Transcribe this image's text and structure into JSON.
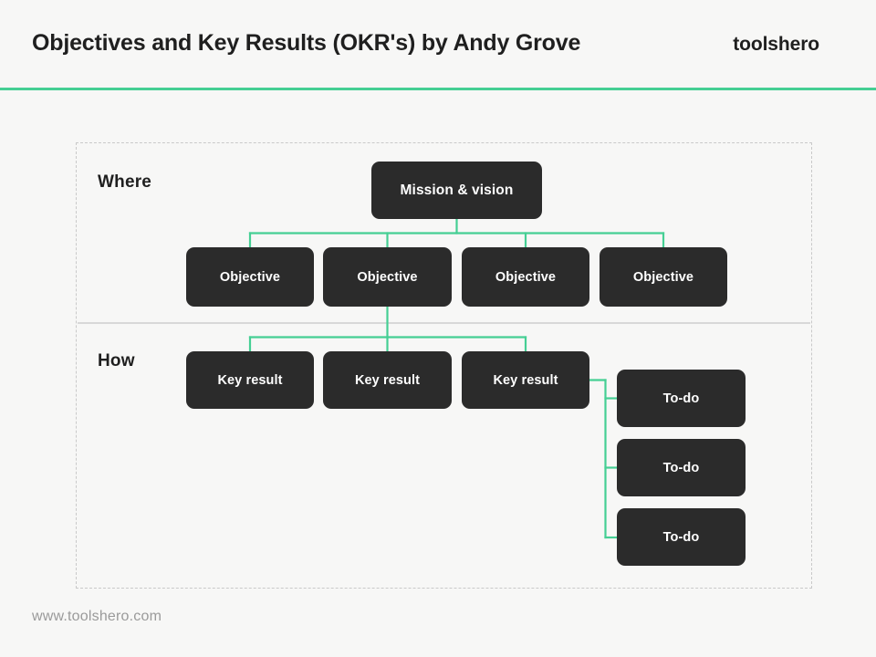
{
  "page": {
    "background_color": "#f7f7f6",
    "accent_color": "#45cf94",
    "node_color": "#2b2b2b",
    "node_text_color": "#ffffff"
  },
  "header": {
    "title": "Objectives and Key Results (OKR's) by Andy Grove",
    "brand": "toolshero",
    "rule_color": "#45cf94"
  },
  "diagram": {
    "sections": [
      {
        "key": "where",
        "label": "Where"
      },
      {
        "key": "how",
        "label": "How"
      }
    ],
    "nodes": {
      "mission": {
        "label": "Mission & vision"
      },
      "objectives": [
        {
          "label": "Objective"
        },
        {
          "label": "Objective"
        },
        {
          "label": "Objective"
        },
        {
          "label": "Objective"
        }
      ],
      "key_results": [
        {
          "label": "Key result"
        },
        {
          "label": "Key result"
        },
        {
          "label": "Key result"
        }
      ],
      "todos": [
        {
          "label": "To-do"
        },
        {
          "label": "To-do"
        },
        {
          "label": "To-do"
        }
      ]
    }
  },
  "footer": {
    "url": "www.toolshero.com"
  }
}
